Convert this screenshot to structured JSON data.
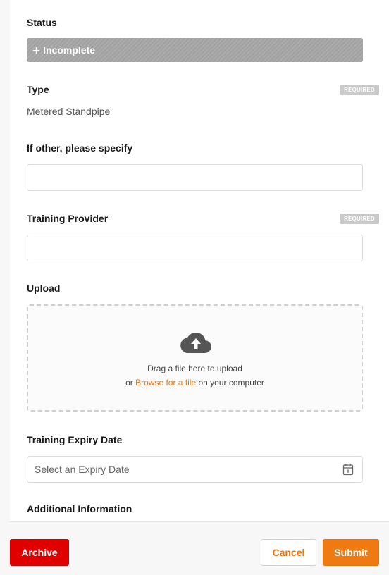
{
  "form": {
    "status": {
      "label": "Status",
      "value": "Incomplete",
      "plus": "+"
    },
    "type": {
      "label": "Type",
      "badge": "REQUIRED",
      "value": "Metered Standpipe"
    },
    "other": {
      "label": "If other, please specify",
      "value": ""
    },
    "training_provider": {
      "label": "Training Provider",
      "badge": "REQUIRED",
      "value": ""
    },
    "upload": {
      "label": "Upload",
      "line1": "Drag a file here to upload",
      "line2_prefix": "or",
      "line2_link": "Browse for a file",
      "line2_suffix": "on your computer"
    },
    "expiry": {
      "label": "Training Expiry Date",
      "placeholder": "Select an Expiry Date"
    },
    "additional": {
      "label": "Additional Information"
    }
  },
  "footer": {
    "archive": "Archive",
    "cancel": "Cancel",
    "submit": "Submit"
  },
  "icons": {
    "upload": "cloud-upload-icon",
    "calendar": "calendar-icon"
  },
  "colors": {
    "accent": "#f07a12",
    "danger": "#e00000",
    "status_bar": "#a6a6a6",
    "badge": "#c9c9c9"
  }
}
